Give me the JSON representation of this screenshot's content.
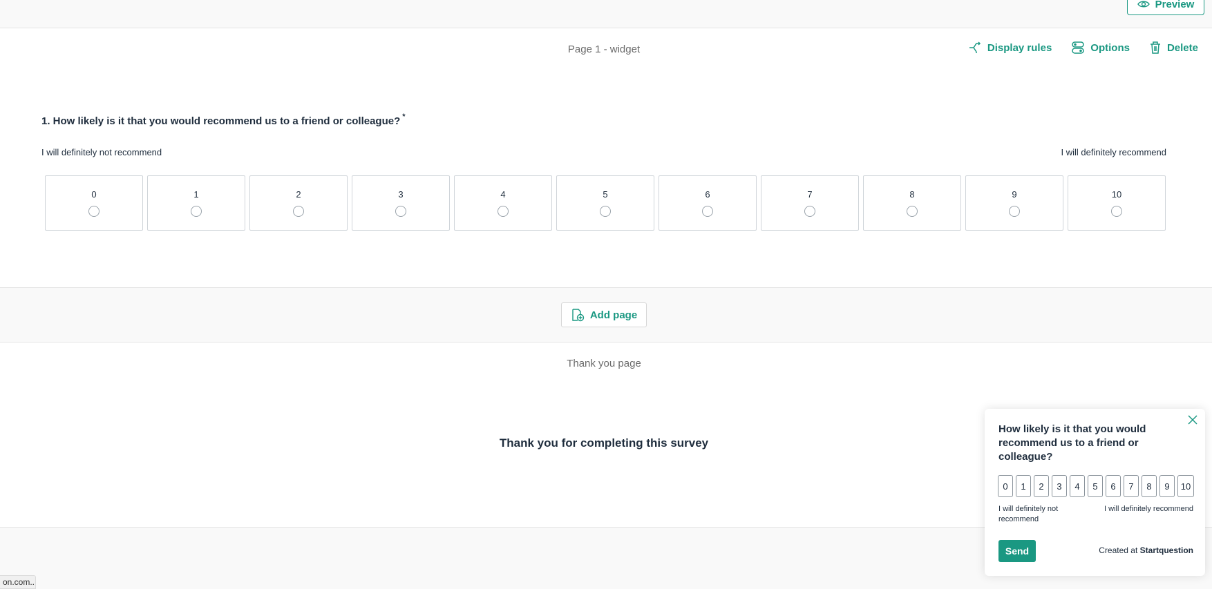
{
  "topbar": {
    "preview_label": "Preview"
  },
  "page": {
    "title": "Page 1 - widget",
    "actions": {
      "display_rules": "Display rules",
      "options": "Options",
      "delete": "Delete"
    }
  },
  "question": {
    "text": "1. How likely is it that you would recommend us to a friend or colleague?",
    "required_mark": "*",
    "label_low": "I will definitely not recommend",
    "label_high": "I will definitely recommend",
    "scale": [
      "0",
      "1",
      "2",
      "3",
      "4",
      "5",
      "6",
      "7",
      "8",
      "9",
      "10"
    ]
  },
  "add_page": {
    "label": "Add page"
  },
  "thank_you": {
    "title": "Thank you page",
    "message": "Thank you for completing this survey"
  },
  "status_url": "on.com...",
  "widget": {
    "question": "How likely is it that you would recommend us to a friend or colleague?",
    "scale": [
      "0",
      "1",
      "2",
      "3",
      "4",
      "5",
      "6",
      "7",
      "8",
      "9",
      "10"
    ],
    "label_low": "I will definitely not recommend",
    "label_high": "I will definitely recommend",
    "send_label": "Send",
    "credit_prefix": "Created at",
    "credit_brand": "Startquestion"
  },
  "colors": {
    "accent": "#1a9882",
    "text": "#1f2d3d",
    "muted": "#6b6b6b"
  }
}
